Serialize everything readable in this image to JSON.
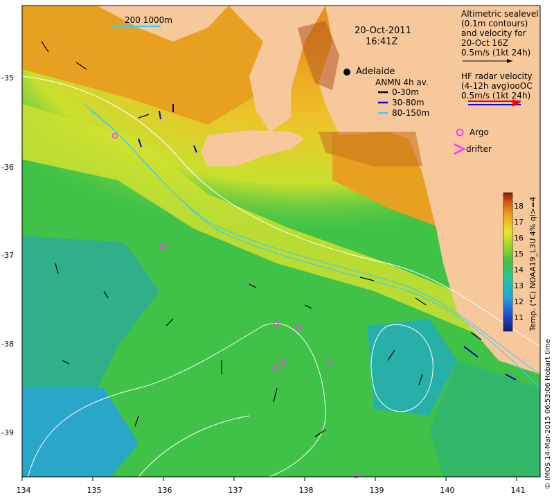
{
  "map": {
    "datetime_line1": "20-Oct-2011",
    "datetime_line2": "16:41Z",
    "city": "Adelaide",
    "scale_label": "200  1000m",
    "colorbar_label": "Temp. (°C) NOAA19_L3U 4% ql>=4",
    "credit": "© IMOS 14-Mar-2015 06:53:06 Hobart time",
    "x_ticks": [
      "134",
      "135",
      "136",
      "137",
      "138",
      "139",
      "140",
      "141"
    ],
    "y_ticks": [
      "-35",
      "-36",
      "-37",
      "-38",
      "-39"
    ],
    "colorbar_ticks": [
      "18",
      "17",
      "16",
      "15",
      "14",
      "13",
      "12",
      "11"
    ]
  },
  "legend": {
    "altimetry_l1": "Altimetric sealevel",
    "altimetry_l2": "(0.1m contours)",
    "altimetry_l3": "and velocity for",
    "altimetry_l4": "20-Oct 16Z",
    "altimetry_l5": "0.5m/s (1kt 24h)",
    "hf_l1": "HF radar velocity",
    "hf_l2": "(4-12h avg)ooOC",
    "hf_l3": "0.5m/s (1kt 24h)",
    "anmn_title": "ANMN 4h av.",
    "anmn_items": [
      {
        "label": "0-30m",
        "color": "#000000"
      },
      {
        "label": "30-80m",
        "color": "#0000cc"
      },
      {
        "label": "80-150m",
        "color": "#33ccff"
      }
    ],
    "argo_label": "Argo",
    "drifter_label": "drifter",
    "argo_color": "#ff33ff",
    "drifter_color": "#ff33ff"
  },
  "colors": {
    "land": "#f7c89b",
    "ocean_green": "#3fc247",
    "warm_orange": "#e88a18",
    "yellow": "#e8e629"
  }
}
